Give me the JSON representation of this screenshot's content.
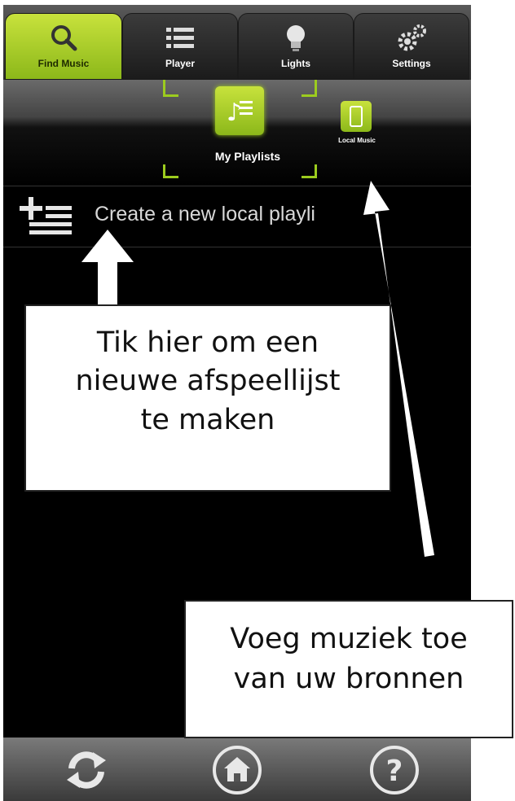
{
  "tabs": [
    {
      "label": "Find Music",
      "icon": "search-icon",
      "active": true
    },
    {
      "label": "Player",
      "icon": "list-icon",
      "active": false
    },
    {
      "label": "Lights",
      "icon": "lightbulb-icon",
      "active": false
    },
    {
      "label": "Settings",
      "icon": "gear-icon",
      "active": false
    }
  ],
  "modes": {
    "playlists": {
      "label": "My Playlists",
      "icon": "playlist-icon",
      "selected": true
    },
    "local": {
      "label": "Local Music",
      "icon": "phone-icon"
    }
  },
  "create_row": {
    "label": "Create a new local playli",
    "icon": "add-list-icon"
  },
  "bottom_bar": [
    {
      "icon": "refresh-icon"
    },
    {
      "icon": "home-icon"
    },
    {
      "icon": "help-icon"
    }
  ],
  "callouts": {
    "create_hint": [
      "Tik hier om een",
      "nieuwe afspeellijst",
      "te maken"
    ],
    "local_hint": [
      "Voeg muziek toe",
      "van uw bronnen"
    ]
  },
  "colors": {
    "accent": "#9ccc1e",
    "background": "#000000"
  }
}
